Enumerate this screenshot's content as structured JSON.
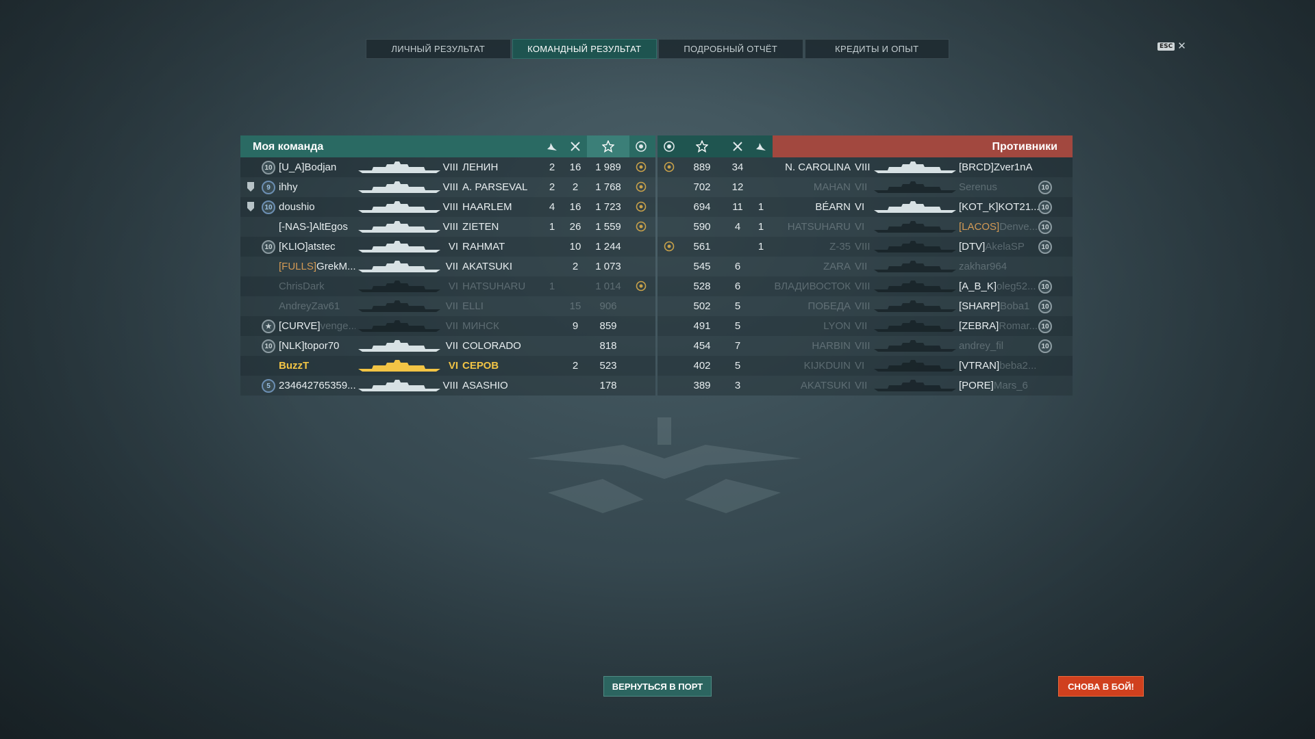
{
  "tabs": [
    "ЛИЧНЫЙ РЕЗУЛЬТАТ",
    "КОМАНДНЫЙ РЕЗУЛЬТАТ",
    "ПОДРОБНЫЙ ОТЧЁТ",
    "КРЕДИТЫ И ОПЫТ"
  ],
  "active_tab": 1,
  "esc": {
    "key": "ESC",
    "close": "✕"
  },
  "my_team": {
    "title": "Моя команда",
    "icons": [
      "planes-icon",
      "kills-icon",
      "xp-star-icon",
      "medal-icon"
    ],
    "rows": [
      {
        "badge": "10",
        "badge_style": "grey",
        "shield": false,
        "clan": "[U_A]",
        "name": "Bodjan",
        "tier": "VIII",
        "ship": "ЛЕНИН",
        "planes": "2",
        "kills": "16",
        "xp": "1 989",
        "medal": true,
        "dim": false,
        "me": false
      },
      {
        "badge": "9",
        "badge_style": "blue",
        "shield": true,
        "clan": "",
        "name": "ihhy",
        "tier": "VIII",
        "ship": "A. PARSEVAL",
        "planes": "2",
        "kills": "2",
        "xp": "1 768",
        "medal": true,
        "dim": false,
        "me": false
      },
      {
        "badge": "10",
        "badge_style": "blue",
        "shield": true,
        "clan": "",
        "name": "doushio",
        "tier": "VIII",
        "ship": "HAARLEM",
        "planes": "4",
        "kills": "16",
        "xp": "1 723",
        "medal": true,
        "dim": false,
        "me": false
      },
      {
        "badge": "",
        "badge_style": "",
        "shield": false,
        "clan": "[-NAS-]",
        "name": "AltEgos",
        "tier": "VIII",
        "ship": "ZIETEN",
        "planes": "1",
        "kills": "26",
        "xp": "1 559",
        "medal": true,
        "dim": false,
        "me": false
      },
      {
        "badge": "10",
        "badge_style": "grey",
        "shield": false,
        "clan": "[KLIO]",
        "name": "atstec",
        "tier": "VI",
        "ship": "RAHMAT",
        "planes": "",
        "kills": "10",
        "xp": "1 244",
        "medal": false,
        "dim": false,
        "me": false
      },
      {
        "badge": "",
        "badge_style": "",
        "shield": false,
        "clan": "[FULLS]",
        "clan_color": "orange",
        "name": "GrekM...",
        "tier": "VII",
        "ship": "AKATSUKI",
        "planes": "",
        "kills": "2",
        "xp": "1 073",
        "medal": false,
        "dim": false,
        "me": false
      },
      {
        "badge": "",
        "badge_style": "",
        "shield": false,
        "clan": "",
        "name": "ChrisDark",
        "tier": "VI",
        "ship": "HATSUHARU",
        "planes": "1",
        "kills": "",
        "xp": "1 014",
        "medal": true,
        "dim": true,
        "me": false
      },
      {
        "badge": "",
        "badge_style": "",
        "shield": false,
        "clan": "",
        "name": "AndreyZav61",
        "tier": "VII",
        "ship": "ELLI",
        "planes": "",
        "kills": "15",
        "xp": "906",
        "medal": false,
        "dim": true,
        "me": false
      },
      {
        "badge": "★",
        "badge_style": "star",
        "shield": false,
        "clan": "[CURVE]",
        "name": "venge...",
        "tier": "VII",
        "ship": "МИНСК",
        "planes": "",
        "kills": "9",
        "xp": "859",
        "medal": false,
        "dim": "partial",
        "me": false
      },
      {
        "badge": "10",
        "badge_style": "grey",
        "shield": false,
        "clan": "[NLK]",
        "name": "topor70",
        "tier": "VII",
        "ship": "COLORADO",
        "planes": "",
        "kills": "",
        "xp": "818",
        "medal": false,
        "dim": false,
        "me": false
      },
      {
        "badge": "",
        "badge_style": "",
        "shield": false,
        "clan": "",
        "name": "BuzzT",
        "tier": "VI",
        "ship": "СЕРОВ",
        "planes": "",
        "kills": "2",
        "xp": "523",
        "medal": false,
        "dim": false,
        "me": true
      },
      {
        "badge": "5",
        "badge_style": "blue",
        "shield": false,
        "clan": "",
        "name": "234642765359...",
        "tier": "VIII",
        "ship": "ASASHIO",
        "planes": "",
        "kills": "",
        "xp": "178",
        "medal": false,
        "dim": false,
        "me": false
      }
    ]
  },
  "enemies": {
    "title": "Противники",
    "icons": [
      "medal-icon",
      "xp-star-icon",
      "kills-icon",
      "planes-icon"
    ],
    "rows": [
      {
        "medal": true,
        "xp": "889",
        "kills": "34",
        "planes": "",
        "ship": "N. CAROLINA",
        "tier": "VIII",
        "clan": "[BRCD]",
        "name": "Zver1nA",
        "badge": "",
        "dim": false
      },
      {
        "medal": false,
        "xp": "702",
        "kills": "12",
        "planes": "",
        "ship": "MAHAN",
        "tier": "VII",
        "clan": "",
        "name": "Serenus",
        "badge": "10",
        "dim": true
      },
      {
        "medal": false,
        "xp": "694",
        "kills": "11",
        "planes": "1",
        "ship": "BÉARN",
        "tier": "VI",
        "clan": "[KOT_K]",
        "name": "KOT21...",
        "badge": "10",
        "dim": false
      },
      {
        "medal": false,
        "xp": "590",
        "kills": "4",
        "planes": "1",
        "ship": "HATSUHARU",
        "tier": "VI",
        "clan": "[LACOS]",
        "clan_color": "orange",
        "name": "Denve...",
        "badge": "10",
        "dim": "partial"
      },
      {
        "medal": true,
        "xp": "561",
        "kills": "",
        "planes": "1",
        "ship": "Z-35",
        "tier": "VIII",
        "clan": "[DTV]",
        "name": "AkelaSP",
        "badge": "10",
        "dim": "partial"
      },
      {
        "medal": false,
        "xp": "545",
        "kills": "6",
        "planes": "",
        "ship": "ZARA",
        "tier": "VII",
        "clan": "",
        "name": "zakhar964",
        "badge": "",
        "dim": true
      },
      {
        "medal": false,
        "xp": "528",
        "kills": "6",
        "planes": "",
        "ship": "ВЛАДИВОСТОК",
        "tier": "VIII",
        "clan": "[A_B_K]",
        "name": "oleg52...",
        "badge": "10",
        "dim": "partial"
      },
      {
        "medal": false,
        "xp": "502",
        "kills": "5",
        "planes": "",
        "ship": "ПОБЕДА",
        "tier": "VIII",
        "clan": "[SHARP]",
        "name": "Boba1",
        "badge": "10",
        "dim": "partial"
      },
      {
        "medal": false,
        "xp": "491",
        "kills": "5",
        "planes": "",
        "ship": "LYON",
        "tier": "VII",
        "clan": "[ZEBRA]",
        "name": "Romar...",
        "badge": "10",
        "dim": "partial"
      },
      {
        "medal": false,
        "xp": "454",
        "kills": "7",
        "planes": "",
        "ship": "HARBIN",
        "tier": "VIII",
        "clan": "",
        "name": "andrey_fil",
        "badge": "10",
        "dim": true
      },
      {
        "medal": false,
        "xp": "402",
        "kills": "5",
        "planes": "",
        "ship": "KIJKDUIN",
        "tier": "VI",
        "clan": "[VTRAN]",
        "name": "beba2...",
        "badge": "",
        "dim": "partial"
      },
      {
        "medal": false,
        "xp": "389",
        "kills": "3",
        "planes": "",
        "ship": "AKATSUKI",
        "tier": "VII",
        "clan": "[PORE]",
        "name": "Mars_6",
        "badge": "",
        "dim": "partial"
      }
    ]
  },
  "buttons": {
    "port": "ВЕРНУТЬСЯ В ПОРТ",
    "battle": "СНОВА В БОЙ!"
  },
  "colors": {
    "accent_team": "#2a6a63",
    "accent_enemy": "#a2483f",
    "me": "#f2c445",
    "battle_button": "#d0401e"
  }
}
